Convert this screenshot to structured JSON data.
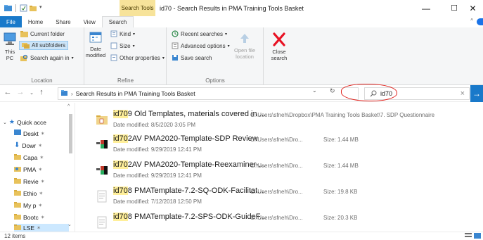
{
  "window": {
    "context_tab_title": "Search Tools",
    "title": "id70 - Search Results in PMA Training Tools Basket",
    "minimize": "—",
    "maximize": "☐",
    "close": "✕"
  },
  "ribbon_tabs": [
    "File",
    "Home",
    "Share",
    "View",
    "Search"
  ],
  "ribbon": {
    "location": {
      "label": "Location",
      "this_pc": "This PC",
      "current_folder": "Current folder",
      "all_subfolders": "All subfolders",
      "search_again_in": "Search again in"
    },
    "refine": {
      "label": "Refine",
      "date_modified": "Date modified",
      "kind": "Kind",
      "size": "Size",
      "other_properties": "Other properties"
    },
    "options": {
      "label": "Options",
      "recent_searches": "Recent searches",
      "advanced_options": "Advanced options",
      "save_search": "Save search",
      "open_file_location": "Open file location"
    },
    "close_search": "Close search"
  },
  "address": {
    "path": "Search Results in PMA Training Tools Basket",
    "search_query": "id70"
  },
  "nav_pane": {
    "items": [
      {
        "label": "Quick acce",
        "pinned": false
      },
      {
        "label": "Deskt",
        "pinned": true
      },
      {
        "label": "Dowr",
        "pinned": true
      },
      {
        "label": "Capa",
        "pinned": true
      },
      {
        "label": "PMA",
        "pinned": true
      },
      {
        "label": "Revie",
        "pinned": true
      },
      {
        "label": "Ethio",
        "pinned": true
      },
      {
        "label": "My p",
        "pinned": true
      },
      {
        "label": "Bootc",
        "pinned": true
      },
      {
        "label": "LSE",
        "pinned": true
      }
    ]
  },
  "results": [
    {
      "highlight": "id70",
      "rest": "9 Old Templates, materials covered in ...",
      "date_label": "Date modified:",
      "date": "8/5/2020 3:05 PM",
      "path": "C:\\Users\\sfneh\\Dropbox\\PMA Training Tools Basket\\7. SDP Questionnaire",
      "size": ""
    },
    {
      "highlight": "id70",
      "rest": "2AV PMA2020-Template-SDP Review",
      "date_label": "Date modified:",
      "date": "9/29/2019 12:41 PM",
      "path": "C:\\Users\\sfneh\\Dro...",
      "size": "Size: 1.44 MB"
    },
    {
      "highlight": "id70",
      "rest": "2AV PMA2020-Template-Reexaminer-...",
      "date_label": "Date modified:",
      "date": "9/29/2019 12:41 PM",
      "path": "C:\\Users\\sfneh\\Dro...",
      "size": "Size: 1.44 MB"
    },
    {
      "highlight": "id70",
      "rest": "8 PMATemplate-7.2-SQ-ODK-Facilitat...",
      "date_label": "Date modified:",
      "date": "7/12/2018 12:50 PM",
      "path": "C:\\Users\\sfneh\\Dro...",
      "size": "Size: 19.8 KB"
    },
    {
      "highlight": "id70",
      "rest": "8 PMATemplate-7.2-SPS-ODK-GuideF...",
      "date_label": "",
      "date": "",
      "path": "C:\\Users\\sfneh\\Dro...",
      "size": "Size: 20.3 KB"
    }
  ],
  "status": {
    "item_count": "12 items"
  },
  "colors": {
    "accent": "#1979ca",
    "highlight": "#ffef9a",
    "annotation_ring": "#e0201b",
    "context_tab": "#f7e39a"
  }
}
